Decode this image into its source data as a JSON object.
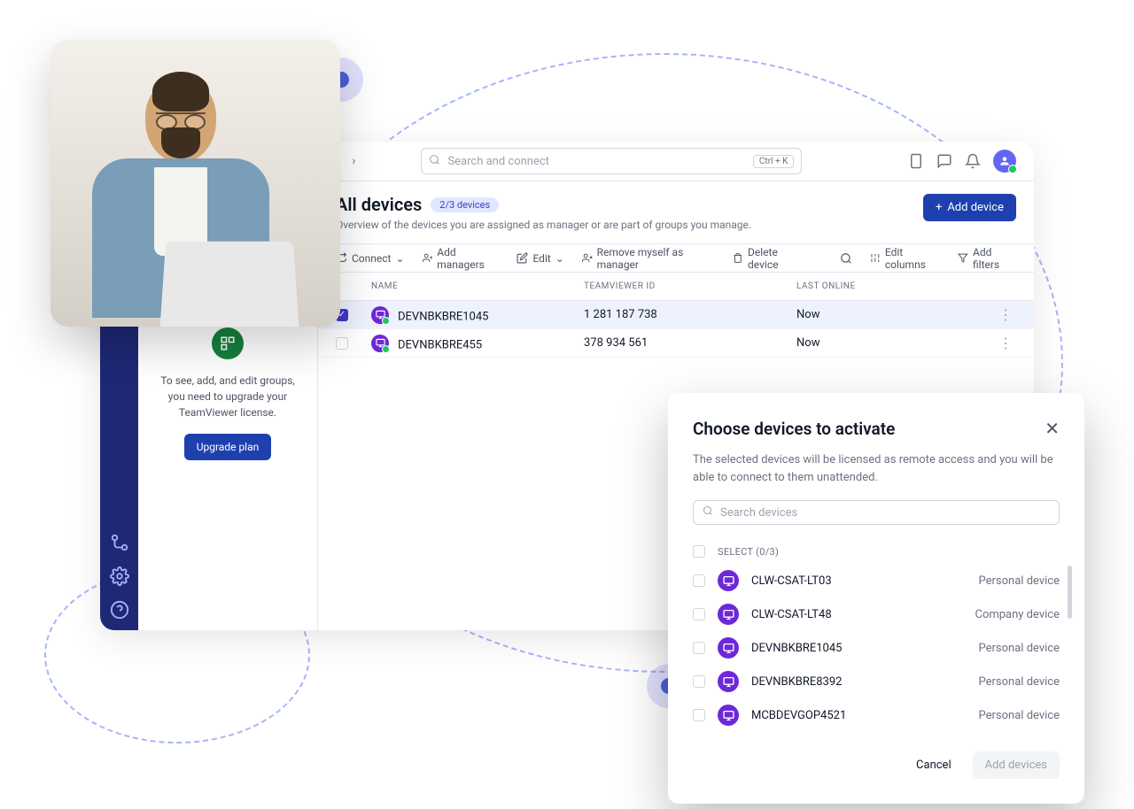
{
  "topbar": {
    "search_placeholder": "Search and connect",
    "shortcut": "Ctrl + K"
  },
  "page": {
    "title": "All devices",
    "badge": "2/3 devices",
    "subtitle": "Overview of the devices you are assigned as manager or are part of groups you manage.",
    "add_device": "Add device"
  },
  "toolbar": {
    "connect": "Connect",
    "add_managers": "Add managers",
    "edit": "Edit",
    "remove_self": "Remove myself as manager",
    "delete": "Delete device",
    "edit_columns": "Edit columns",
    "add_filters": "Add filters"
  },
  "columns": {
    "name": "NAME",
    "id": "TEAMVIEWER ID",
    "online": "LAST ONLINE"
  },
  "devices": [
    {
      "name": "DEVNBKBRE1045",
      "id": "1 281 187 738",
      "online": "Now",
      "selected": true
    },
    {
      "name": "DEVNBKBRE455",
      "id": "378 934 561",
      "online": "Now",
      "selected": false
    }
  ],
  "groups": {
    "text": "To see, add, and edit groups, you need to upgrade your TeamViewer license.",
    "upgrade": "Upgrade plan"
  },
  "modal": {
    "title": "Choose devices to activate",
    "description": "The selected devices will be licensed as remote access and you will be able to connect to them unattended.",
    "search_placeholder": "Search devices",
    "select_label": "SELECT (0/3)",
    "devices": [
      {
        "name": "CLW-CSAT-LT03",
        "type": "Personal device"
      },
      {
        "name": "CLW-CSAT-LT48",
        "type": "Company device"
      },
      {
        "name": "DEVNBKBRE1045",
        "type": "Personal device"
      },
      {
        "name": "DEVNBKBRE8392",
        "type": "Personal device"
      },
      {
        "name": "MCBDEVGOP4521",
        "type": "Personal device"
      }
    ],
    "cancel": "Cancel",
    "add": "Add devices"
  }
}
